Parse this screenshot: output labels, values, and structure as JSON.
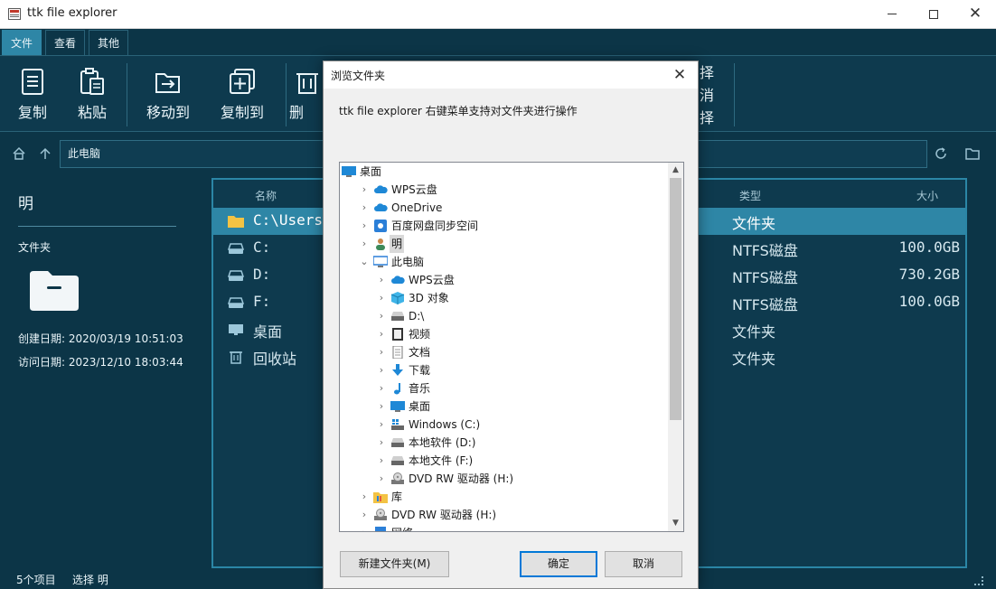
{
  "window": {
    "title": "ttk file explorer",
    "min_glyph": "—",
    "close_glyph": "✕"
  },
  "menu": {
    "tabs": [
      {
        "label": "文件"
      },
      {
        "label": "查看"
      },
      {
        "label": "其他"
      }
    ]
  },
  "ribbon": {
    "copy": "复制",
    "paste": "粘贴",
    "move_to": "移动到",
    "copy_to": "复制到",
    "delete_partial": "删",
    "right_1": "择",
    "right_2": "消",
    "right_3": "择"
  },
  "address": {
    "path": "此电脑"
  },
  "details": {
    "name": "明",
    "type": "文件夹",
    "created": "创建日期: 2020/03/19 10:51:03",
    "accessed": "访问日期: 2023/12/10 18:03:44"
  },
  "file_list": {
    "columns": {
      "name": "名称",
      "type": "类型",
      "size": "大小"
    },
    "rows": [
      {
        "name": "C:\\Users\\",
        "type": "文件夹",
        "size": "",
        "icon": "folder-icon"
      },
      {
        "name": "C:",
        "type": "NTFS磁盘",
        "size": "100.0GB",
        "icon": "drive-icon"
      },
      {
        "name": "D:",
        "type": "NTFS磁盘",
        "size": "730.2GB",
        "icon": "drive-icon"
      },
      {
        "name": "F:",
        "type": "NTFS磁盘",
        "size": "100.0GB",
        "icon": "drive-icon"
      },
      {
        "name": "桌面",
        "type": "文件夹",
        "size": "",
        "icon": "desktop-icon"
      },
      {
        "name": "回收站",
        "type": "文件夹",
        "size": "",
        "icon": "recycle-bin-icon"
      }
    ]
  },
  "status": {
    "count": "5个项目",
    "selection": "选择 明"
  },
  "dialog": {
    "title": "浏览文件夹",
    "close_glyph": "✕",
    "description": "ttk file explorer 右键菜单支持对文件夹进行操作",
    "tree": [
      {
        "label": "桌面",
        "level": 0,
        "chevron": "",
        "icon": "desktop-icon"
      },
      {
        "label": "WPS云盘",
        "level": 1,
        "chevron": ">",
        "icon": "cloud-icon"
      },
      {
        "label": "OneDrive",
        "level": 1,
        "chevron": ">",
        "icon": "cloud-icon"
      },
      {
        "label": "百度网盘同步空间",
        "level": 1,
        "chevron": ">",
        "icon": "sync-icon"
      },
      {
        "label": "明",
        "level": 1,
        "chevron": ">",
        "icon": "user-icon",
        "selected": true
      },
      {
        "label": "此电脑",
        "level": 1,
        "chevron": "v",
        "icon": "computer-icon"
      },
      {
        "label": "WPS云盘",
        "level": 2,
        "chevron": ">",
        "icon": "cloud-icon"
      },
      {
        "label": "3D 对象",
        "level": 2,
        "chevron": ">",
        "icon": "cube-icon"
      },
      {
        "label": "D:\\",
        "level": 2,
        "chevron": ">",
        "icon": "drive-icon"
      },
      {
        "label": "视频",
        "level": 2,
        "chevron": ">",
        "icon": "video-icon"
      },
      {
        "label": "文档",
        "level": 2,
        "chevron": ">",
        "icon": "document-icon"
      },
      {
        "label": "下载",
        "level": 2,
        "chevron": ">",
        "icon": "download-icon"
      },
      {
        "label": "音乐",
        "level": 2,
        "chevron": ">",
        "icon": "music-icon"
      },
      {
        "label": "桌面",
        "level": 2,
        "chevron": ">",
        "icon": "desktop-icon"
      },
      {
        "label": "Windows (C:)",
        "level": 2,
        "chevron": ">",
        "icon": "windows-drive-icon"
      },
      {
        "label": "本地软件 (D:)",
        "level": 2,
        "chevron": ">",
        "icon": "drive-icon"
      },
      {
        "label": "本地文件 (F:)",
        "level": 2,
        "chevron": ">",
        "icon": "drive-icon"
      },
      {
        "label": "DVD RW 驱动器 (H:)",
        "level": 2,
        "chevron": ">",
        "icon": "dvd-icon"
      },
      {
        "label": "库",
        "level": 1,
        "chevron": ">",
        "icon": "library-icon"
      },
      {
        "label": "DVD RW 驱动器 (H:)",
        "level": 1,
        "chevron": ">",
        "icon": "dvd-icon"
      },
      {
        "label": "网络",
        "level": 1,
        "chevron": ">",
        "icon": "network-icon"
      }
    ],
    "buttons": {
      "new_folder": "新建文件夹(M)",
      "ok": "确定",
      "cancel": "取消"
    }
  }
}
